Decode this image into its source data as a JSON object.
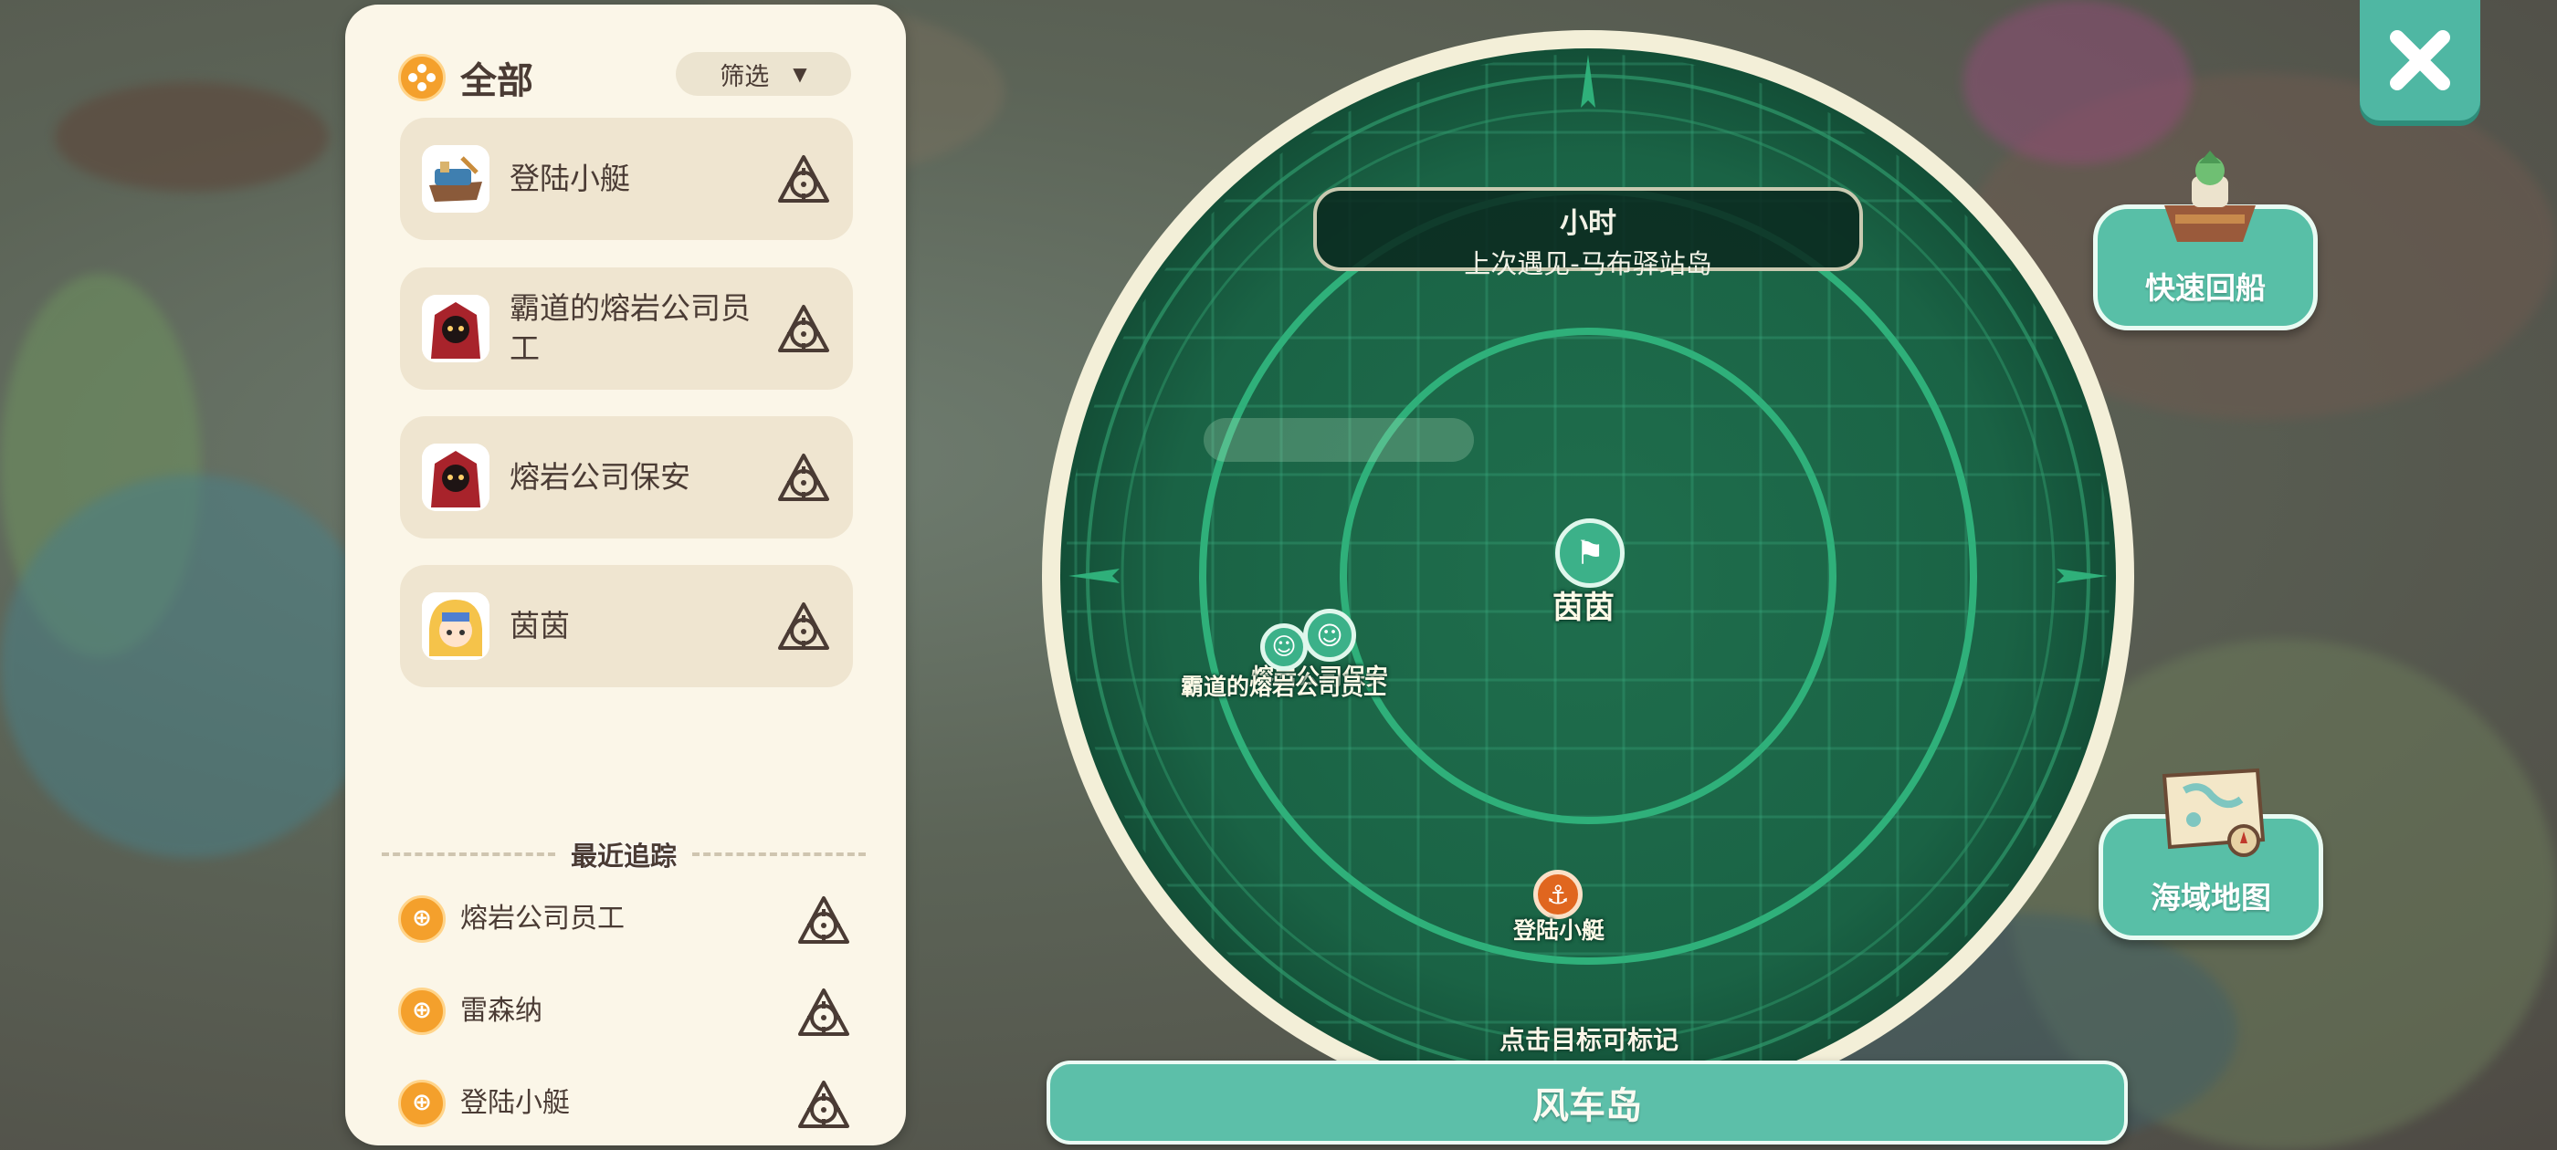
{
  "panel": {
    "title": "全部",
    "filter_label": "筛选",
    "items": [
      {
        "label": "登陆小艇",
        "icon": "boat-icon"
      },
      {
        "label": "霸道的熔岩公司员工",
        "icon": "lava-worker-icon"
      },
      {
        "label": "熔岩公司保安",
        "icon": "lava-guard-icon"
      },
      {
        "label": "茵茵",
        "icon": "yinyin-portrait-icon"
      }
    ],
    "recent_title": "最近追踪",
    "recent": [
      {
        "label": "熔岩公司员工"
      },
      {
        "label": "雷森纳"
      },
      {
        "label": "登陆小艇"
      }
    ]
  },
  "radar": {
    "status_line1": "小时",
    "status_line2": "上次遇见-马布驿站岛",
    "markers": [
      {
        "label": "茵茵",
        "icon": "flag-icon"
      },
      {
        "label": "熔岩公司保安",
        "icon": "face-icon"
      },
      {
        "label": "霸道的熔岩公司员工",
        "icon": "face-icon"
      },
      {
        "label": "登陆小艇",
        "icon": "anchor-icon"
      }
    ],
    "hint": "点击目标可标记",
    "island_name": "风车岛"
  },
  "side": {
    "quick_return_label": "快速回船",
    "sea_map_label": "海域地图"
  },
  "colors": {
    "accent": "#58bfa7",
    "radar": "#1d6b4a",
    "badge": "#f4a02c",
    "panel": "#fbf6e8"
  }
}
